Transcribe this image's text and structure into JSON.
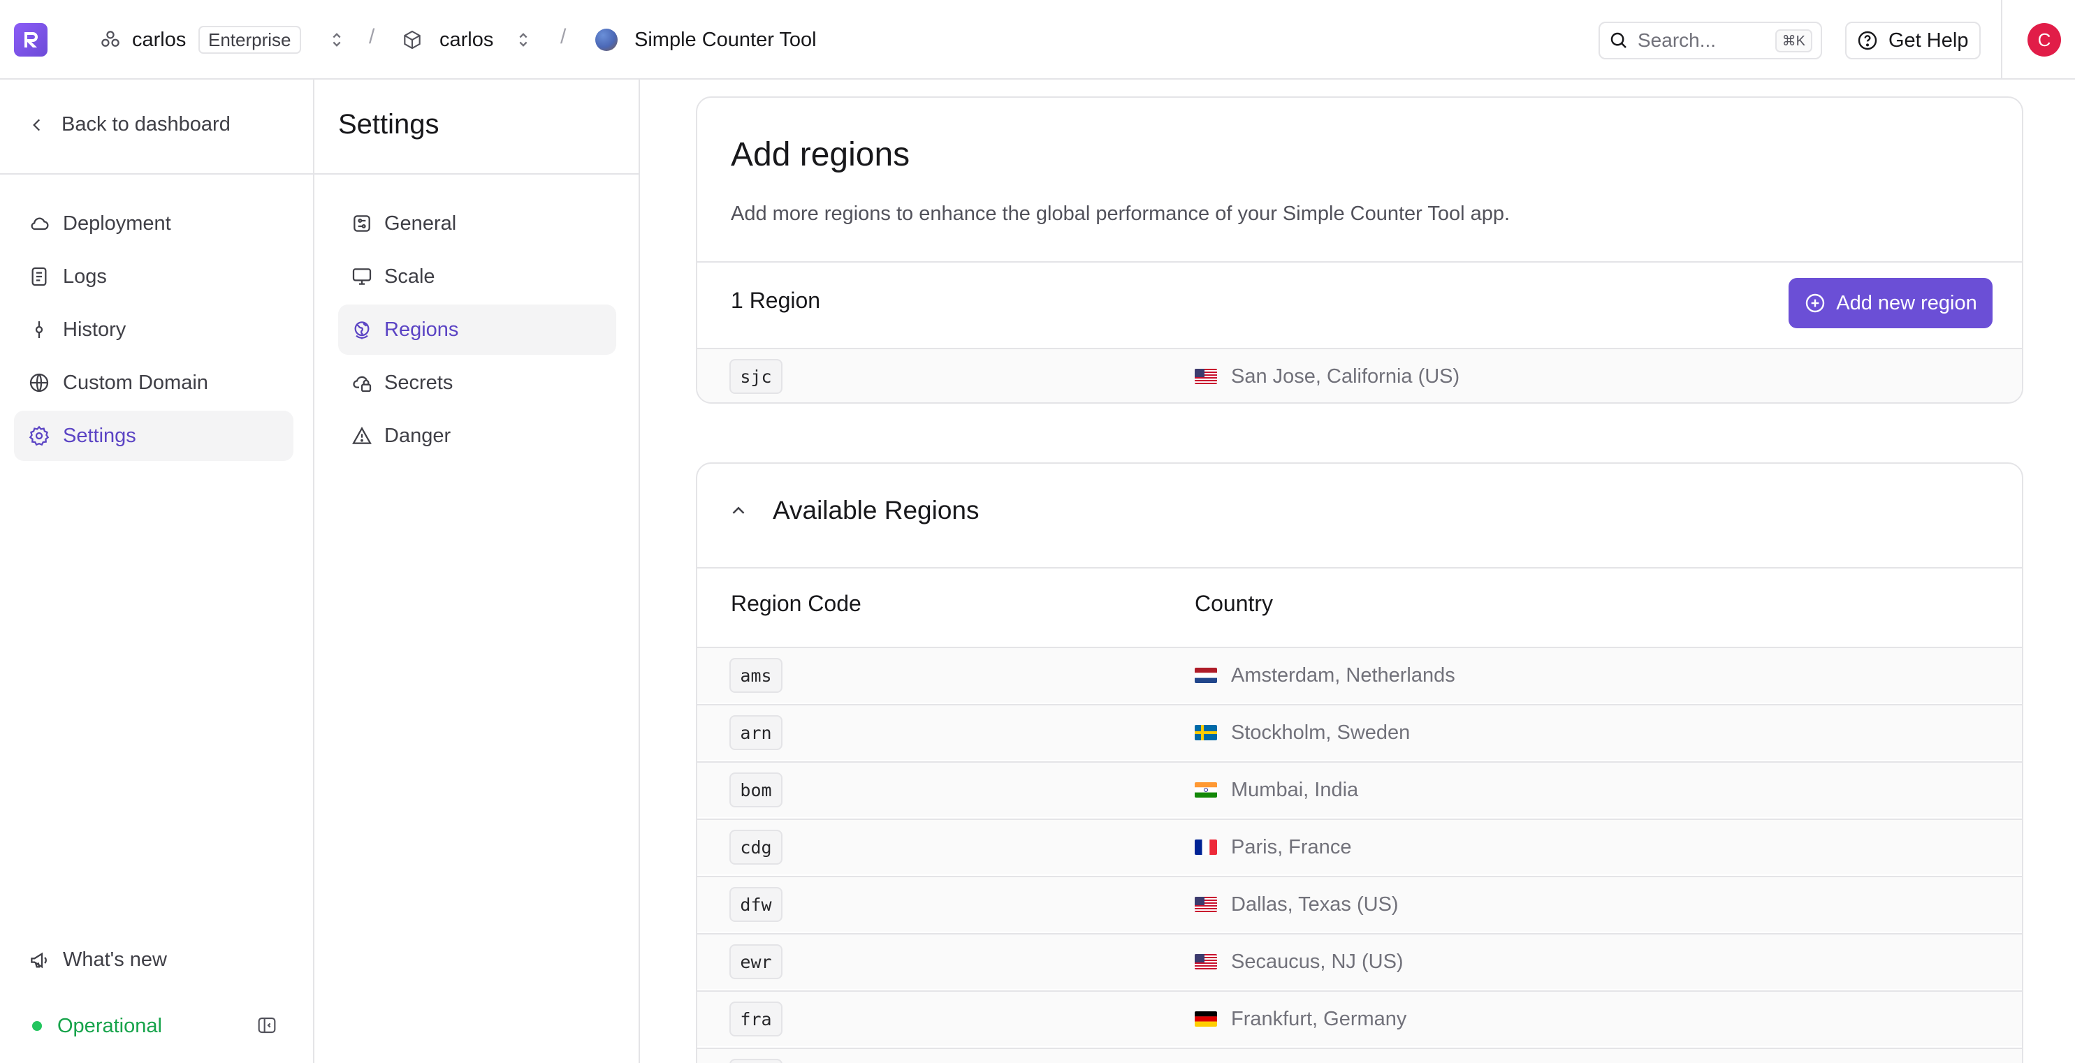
{
  "topbar": {
    "team_name": "carlos",
    "plan_badge": "Enterprise",
    "separator": "/",
    "project_name": "carlos",
    "app_name": "Simple Counter Tool",
    "search_placeholder": "Search...",
    "search_shortcut": "⌘K",
    "help_label": "Get Help",
    "avatar_initial": "C"
  },
  "sidebar": {
    "back_label": "Back to dashboard",
    "items": [
      {
        "label": "Deployment",
        "icon": "cloud-icon"
      },
      {
        "label": "Logs",
        "icon": "file-text-icon"
      },
      {
        "label": "History",
        "icon": "git-commit-icon"
      },
      {
        "label": "Custom Domain",
        "icon": "globe-icon"
      },
      {
        "label": "Settings",
        "icon": "gear-icon",
        "active": true
      }
    ],
    "whats_new_label": "What's new",
    "status_label": "Operational",
    "status_color": "#22c55e"
  },
  "settings_nav": {
    "title": "Settings",
    "items": [
      {
        "label": "General",
        "icon": "sliders-icon"
      },
      {
        "label": "Scale",
        "icon": "monitor-icon"
      },
      {
        "label": "Regions",
        "icon": "earth-icon",
        "active": true
      },
      {
        "label": "Secrets",
        "icon": "cloud-lock-icon"
      },
      {
        "label": "Danger",
        "icon": "warning-triangle-icon"
      }
    ]
  },
  "add_regions": {
    "title": "Add regions",
    "description": "Add more regions to enhance the global performance of your Simple Counter Tool app.",
    "count_label": "1 Region",
    "add_button_label": "Add new region",
    "regions": [
      {
        "code": "sjc",
        "location": "San Jose, California (US)",
        "flag": "us"
      }
    ]
  },
  "available_regions": {
    "title": "Available Regions",
    "col_code": "Region Code",
    "col_country": "Country",
    "rows": [
      {
        "code": "ams",
        "location": "Amsterdam, Netherlands",
        "flag": "nl"
      },
      {
        "code": "arn",
        "location": "Stockholm, Sweden",
        "flag": "se"
      },
      {
        "code": "bom",
        "location": "Mumbai, India",
        "flag": "in"
      },
      {
        "code": "cdg",
        "location": "Paris, France",
        "flag": "fr"
      },
      {
        "code": "dfw",
        "location": "Dallas, Texas (US)",
        "flag": "us"
      },
      {
        "code": "ewr",
        "location": "Secaucus, NJ (US)",
        "flag": "us"
      },
      {
        "code": "fra",
        "location": "Frankfurt, Germany",
        "flag": "de"
      }
    ]
  },
  "colors": {
    "accent": "#6b4fd6",
    "active_text": "#5b44c4",
    "border": "#e4e4e7"
  }
}
